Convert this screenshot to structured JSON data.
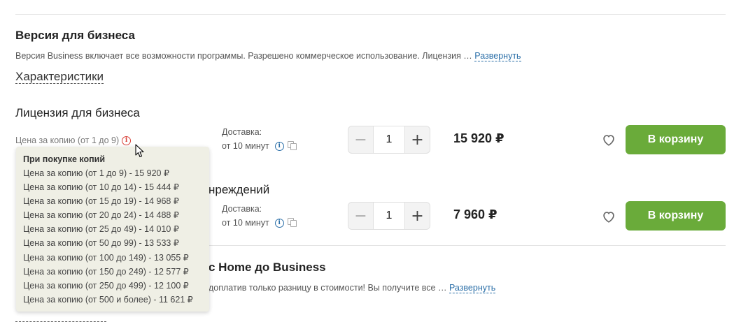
{
  "section": {
    "title": "Версия для бизнеса",
    "description": "Версия Business включает все возможности программы. Разрешено коммерческое использование. Лицензия …",
    "expand_label": "Развернуть",
    "characteristics_label": "Характеристики"
  },
  "products": [
    {
      "name": "Лицензия для бизнеса",
      "price_label": "Цена за копию (от 1 до 9)",
      "delivery_label": "Доставка:",
      "delivery_time": "от 10 минут",
      "quantity": "1",
      "price": "15 920 ₽",
      "cart_label": "В корзину"
    },
    {
      "name_visible": "нреждений",
      "delivery_label": "Доставка:",
      "delivery_time": "от 10 минут",
      "quantity": "1",
      "price": "7 960 ₽",
      "cart_label": "В корзину"
    }
  ],
  "upgrade": {
    "title_visible": "с Home до Business",
    "description_visible": "доплатив только разницу в стоимости! Вы получите все …",
    "expand_label": "Развернуть"
  },
  "tooltip": {
    "title": "При покупке копий",
    "rows": [
      "Цена за копию (от 1 до 9) - 15 920 ₽",
      "Цена за копию (от 10 до 14) - 15 444 ₽",
      "Цена за копию (от 15 до 19) - 14 968 ₽",
      "Цена за копию (от 20 до 24) - 14 488 ₽",
      "Цена за копию (от 25 до 49) - 14 010 ₽",
      "Цена за копию (от 50 до 99) - 13 533 ₽",
      "Цена за копию (от 100 до 149) - 13 055 ₽",
      "Цена за копию (от 150 до 249) - 12 577 ₽",
      "Цена за копию (от 250 до 499) - 12 100 ₽",
      "Цена за копию (от 500 и более) - 11 621 ₽"
    ]
  },
  "icons": {
    "price_info": "info-icon",
    "delivery_info": "info-icon",
    "copy": "copy-icon",
    "favorite": "heart-icon",
    "cursor": "mouse-pointer-icon"
  },
  "colors": {
    "accent_green": "#6aab3a",
    "link_blue": "#2b6fa8",
    "info_red": "#d9423a",
    "tooltip_bg": "#efefe5"
  }
}
